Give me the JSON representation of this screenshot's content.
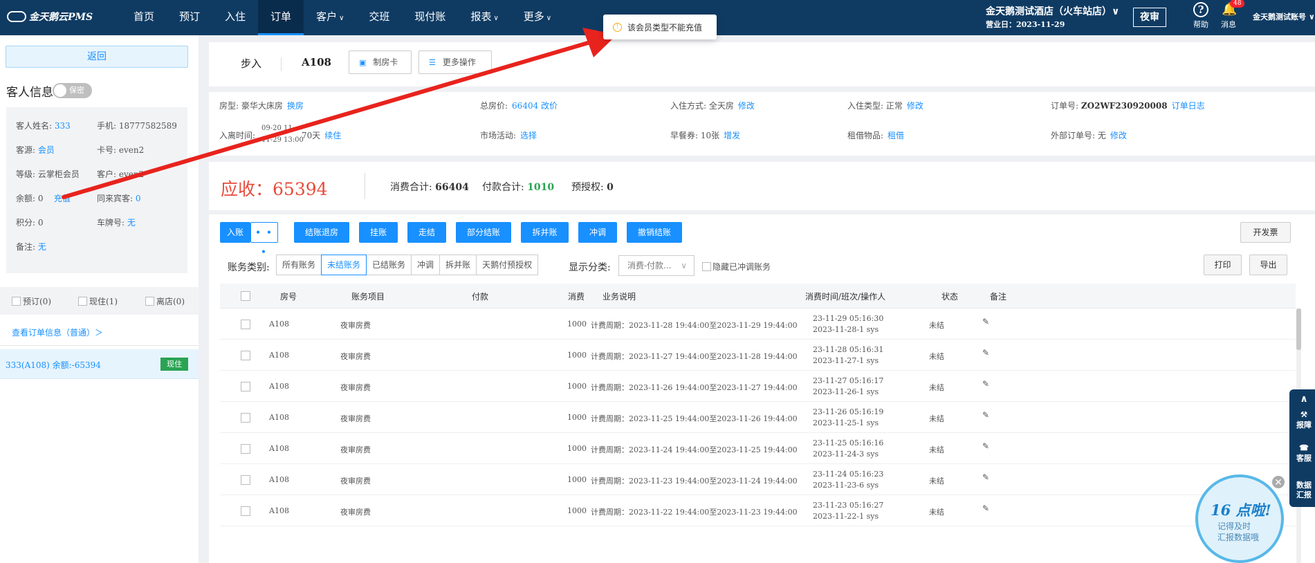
{
  "app": {
    "logo": "金天鹅云PMS",
    "nav": [
      "首页",
      "预订",
      "入住",
      "订单",
      "客户",
      "交班",
      "现付账",
      "报表",
      "更多"
    ],
    "nav_caret": [
      "",
      "",
      "",
      "",
      "∨",
      "",
      "",
      "∨",
      "∨"
    ],
    "active_nav": 3,
    "hotel": "金天鹅测试酒店（火车站店）∨",
    "business_date": "营业日：2023-11-29",
    "night_audit": "夜审",
    "help": "帮助",
    "messages": "消息",
    "message_count": "48",
    "user": "金天鹅测试账号 ∨"
  },
  "toast": {
    "text": "该会员类型不能充值"
  },
  "left": {
    "back": "返回",
    "guest_title": "客人信息",
    "secret_toggle": "保密",
    "guest": {
      "name_label": "客人姓名:",
      "name": "333",
      "phone_label": "手机:",
      "phone": "18777582589",
      "source_label": "客源:",
      "source": "会员",
      "card_label": "卡号:",
      "card": "even2",
      "level_label": "等级:",
      "level": "云掌柜会员",
      "customer_label": "客户:",
      "customer": "even2",
      "balance_label": "余额:",
      "balance": "0",
      "recharge": "充值",
      "companion_label": "同来宾客:",
      "companion": "0",
      "points_label": "积分:",
      "points": "0",
      "plate_label": "车牌号:",
      "plate": "无",
      "remark_label": "备注:",
      "remark": "无"
    },
    "filters": [
      "预订(0)",
      "现住(1)",
      "离店(0)"
    ],
    "view_order": "查看订单信息（普通）＞",
    "room_item": "333(A108)  余额:-65394",
    "room_tag": "现住"
  },
  "header": {
    "walk_in": "步入",
    "room": "A108",
    "make_card": "制房卡",
    "more_ops": "更多操作"
  },
  "info": {
    "room_type_label": "房型:",
    "room_type": "豪华大床房",
    "change_room": "换房",
    "total_label": "总房价:",
    "total": "66404 改价",
    "checkin_mode_label": "入住方式:",
    "checkin_mode": "全天房",
    "checkin_mode_edit": "修改",
    "checkin_type_label": "入住类型:",
    "checkin_type": "正常",
    "checkin_type_edit": "修改",
    "order_no_label": "订单号:",
    "order_no": "ZO2WF230920008",
    "order_log": "订单日志",
    "stay_label": "入离时间:",
    "stay_from": "09-20 11:",
    "stay_to": "11-29 13:00",
    "stay_days": "70天",
    "extend": "续住",
    "market_label": "市场活动:",
    "market": "选择",
    "breakfast_label": "早餐券:",
    "breakfast": "10张",
    "breakfast_add": "增发",
    "rent_label": "租借物品:",
    "rent": "租借",
    "ext_order_label": "外部订单号:",
    "ext_order": "无",
    "ext_order_edit": "修改"
  },
  "summary": {
    "due_label": "应收：",
    "due": "65394",
    "consume_label": "消费合计:",
    "consume": "66404",
    "pay_label": "付款合计:",
    "pay": "1010",
    "preauth_label": "预授权:",
    "preauth": "0"
  },
  "actions": {
    "post": "入账",
    "more": "• • •",
    "buttons": [
      "结账退房",
      "挂账",
      "走结",
      "部分结账",
      "拆并账",
      "冲调",
      "撤销结账"
    ],
    "invoice": "开发票",
    "print": "打印",
    "export": "导出"
  },
  "filters": {
    "category_label": "账务类别:",
    "categories": [
      "所有账务",
      "未结账务",
      "已结账务",
      "冲调",
      "拆并账",
      "天鹅付预授权"
    ],
    "active_category": 1,
    "display_label": "显示分类:",
    "display_value": "消费-付款...",
    "hide_label": "隐藏已冲调账务"
  },
  "table": {
    "headers": [
      "房号",
      "账务项目",
      "付款",
      "消费",
      "业务说明",
      "消费时间/班次/操作人",
      "状态",
      "备注"
    ],
    "rows": [
      {
        "room": "A108",
        "item": "夜审房费",
        "pay": "",
        "consume": "1000",
        "desc": "计费周期：2023-11-28 19:44:00至2023-11-29 19:44:00",
        "time": "23-11-29 05:16:30",
        "shift": "2023-11-28-1 sys",
        "status": "未结"
      },
      {
        "room": "A108",
        "item": "夜审房费",
        "pay": "",
        "consume": "1000",
        "desc": "计费周期：2023-11-27 19:44:00至2023-11-28 19:44:00",
        "time": "23-11-28 05:16:31",
        "shift": "2023-11-27-1 sys",
        "status": "未结"
      },
      {
        "room": "A108",
        "item": "夜审房费",
        "pay": "",
        "consume": "1000",
        "desc": "计费周期：2023-11-26 19:44:00至2023-11-27 19:44:00",
        "time": "23-11-27 05:16:17",
        "shift": "2023-11-26-1 sys",
        "status": "未结"
      },
      {
        "room": "A108",
        "item": "夜审房费",
        "pay": "",
        "consume": "1000",
        "desc": "计费周期：2023-11-25 19:44:00至2023-11-26 19:44:00",
        "time": "23-11-26 05:16:19",
        "shift": "2023-11-25-1 sys",
        "status": "未结"
      },
      {
        "room": "A108",
        "item": "夜审房费",
        "pay": "",
        "consume": "1000",
        "desc": "计费周期：2023-11-24 19:44:00至2023-11-25 19:44:00",
        "time": "23-11-25 05:16:16",
        "shift": "2023-11-24-3 sys",
        "status": "未结"
      },
      {
        "room": "A108",
        "item": "夜审房费",
        "pay": "",
        "consume": "1000",
        "desc": "计费周期：2023-11-23 19:44:00至2023-11-24 19:44:00",
        "time": "23-11-24 05:16:23",
        "shift": "2023-11-23-6 sys",
        "status": "未结"
      },
      {
        "room": "A108",
        "item": "夜审房费",
        "pay": "",
        "consume": "1000",
        "desc": "计费周期：2023-11-22 19:44:00至2023-11-23 19:44:00",
        "time": "23-11-23 05:16:27",
        "shift": "2023-11-22-1 sys",
        "status": "未结"
      }
    ]
  },
  "side": {
    "report": "报障",
    "service": "客服",
    "data": "数据汇报"
  },
  "reminder": {
    "headline": "16 点啦!",
    "line1": "记得及时",
    "line2": "汇报数据哦"
  },
  "colors": {
    "nav_bg": "#0f3b63",
    "accent": "#1890ff",
    "due": "#e74c3c",
    "paid": "#2aa353",
    "annotation": "#e8231d"
  }
}
